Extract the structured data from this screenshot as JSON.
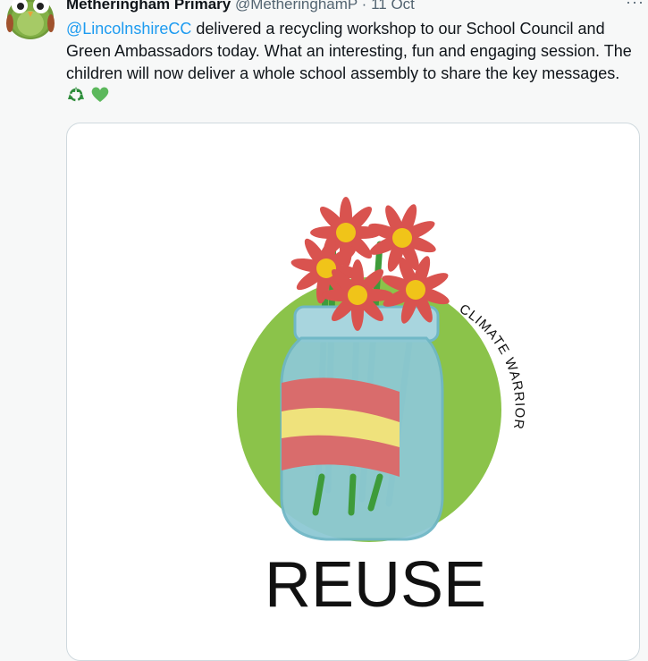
{
  "tweet": {
    "author_name": "Metheringham Primary",
    "author_handle": "@MetheringhamP",
    "separator": "·",
    "timestamp": "11 Oct",
    "more_label": "···",
    "mention": "@LincolnshireCC",
    "body": " delivered a recycling workshop to our School Council and Green Ambassadors today. What an interesting, fun and engaging session. The children will now deliver a whole school assembly to share the key messages. ",
    "emojis": [
      "recycle-icon",
      "green-heart-icon"
    ]
  },
  "media": {
    "circle_text": "CLIMATE WARRIOR",
    "caption": "REUSE",
    "colors": {
      "circle": "#8bc34a",
      "jar": "#8ec9d4",
      "label_red": "#d96c6c",
      "label_yellow": "#efe27c",
      "petal": "#d9534f",
      "center": "#f0c419",
      "stem": "#3e9b3a"
    }
  }
}
